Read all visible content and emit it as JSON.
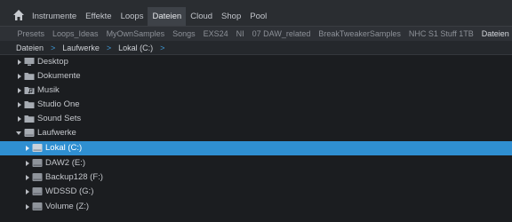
{
  "nav": {
    "tabs": [
      {
        "label": "Instrumente"
      },
      {
        "label": "Effekte"
      },
      {
        "label": "Loops"
      },
      {
        "label": "Dateien",
        "active": true
      },
      {
        "label": "Cloud"
      },
      {
        "label": "Shop"
      },
      {
        "label": "Pool"
      }
    ]
  },
  "subnav": {
    "tabs": [
      {
        "label": "Presets"
      },
      {
        "label": "Loops_Ideas"
      },
      {
        "label": "MyOwnSamples"
      },
      {
        "label": "Songs"
      },
      {
        "label": "EXS24"
      },
      {
        "label": "NI"
      },
      {
        "label": "07 DAW_related"
      },
      {
        "label": "BreakTweakerSamples"
      },
      {
        "label": "NHC S1 Stuff 1TB"
      },
      {
        "label": "Dateien",
        "active": true
      }
    ]
  },
  "breadcrumb": {
    "items": [
      "Dateien",
      "Laufwerke",
      "Lokal (C:)"
    ],
    "separator": ">"
  },
  "tree": {
    "items": [
      {
        "label": "Desktop",
        "icon": "monitor-icon",
        "expanded": false
      },
      {
        "label": "Dokumente",
        "icon": "folder-icon",
        "expanded": false
      },
      {
        "label": "Musik",
        "icon": "music-folder-icon",
        "expanded": false
      },
      {
        "label": "Studio One",
        "icon": "folder-icon",
        "expanded": false
      },
      {
        "label": "Sound Sets",
        "icon": "folder-icon",
        "expanded": false
      },
      {
        "label": "Laufwerke",
        "icon": "drives-icon",
        "expanded": true
      },
      {
        "label": "Lokal (C:)",
        "icon": "drive-icon",
        "selected": true
      },
      {
        "label": "DAW2 (E:)",
        "icon": "drive-icon"
      },
      {
        "label": "Backup128 (F:)",
        "icon": "drive-icon"
      },
      {
        "label": "WDSSD (G:)",
        "icon": "drive-icon"
      },
      {
        "label": "Volume (Z:)",
        "icon": "drive-icon"
      }
    ]
  },
  "colors": {
    "background": "#1b1d20",
    "selection": "#2f8fd1",
    "accent": "#3f9ad8"
  }
}
